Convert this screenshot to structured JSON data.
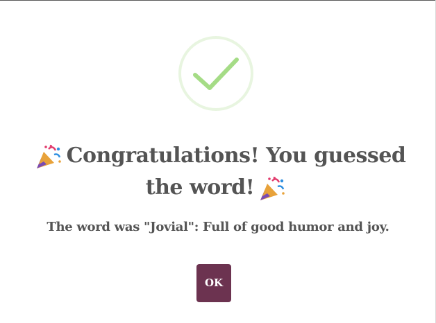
{
  "dialog": {
    "icon": "success-checkmark-icon",
    "title_line": "Congratulations! You guessed the word!",
    "title_emoji": "party-popper-icon",
    "message": "The word was \"Jovial\": Full of good humor and joy.",
    "ok_label": "OK"
  },
  "colors": {
    "check_stroke": "#a5dc86",
    "check_ring": "#e8f5e0",
    "text": "#545454",
    "button_bg": "#6c3350",
    "button_text": "#ffffff"
  }
}
